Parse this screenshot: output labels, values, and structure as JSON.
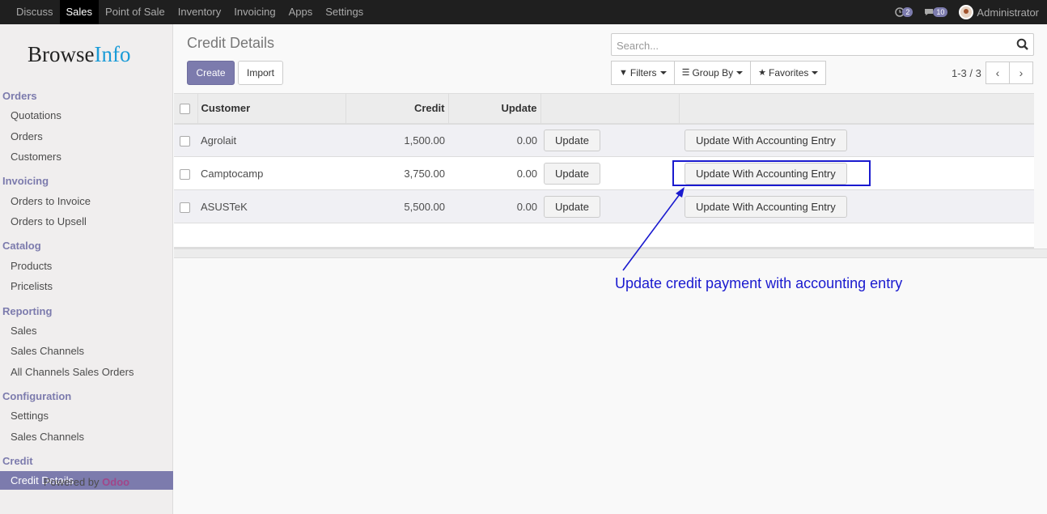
{
  "topbar": {
    "menu": [
      "Discuss",
      "Sales",
      "Point of Sale",
      "Inventory",
      "Invoicing",
      "Apps",
      "Settings"
    ],
    "active": "Sales",
    "activity_count": "2",
    "message_count": "10",
    "user": "Administrator"
  },
  "sidebar": {
    "logo_a": "Browse",
    "logo_b": "Info",
    "sections": {
      "orders": "Orders",
      "invoicing": "Invoicing",
      "catalog": "Catalog",
      "reporting": "Reporting",
      "configuration": "Configuration",
      "credit": "Credit"
    },
    "items": {
      "quotations": "Quotations",
      "orders": "Orders",
      "customers": "Customers",
      "orders_to_invoice": "Orders to Invoice",
      "orders_to_upsell": "Orders to Upsell",
      "products": "Products",
      "pricelists": "Pricelists",
      "sales": "Sales",
      "sales_channels": "Sales Channels",
      "all_channels": "All Channels Sales Orders",
      "settings": "Settings",
      "config_sales_channels": "Sales Channels",
      "credit_details": "Credit Details"
    },
    "powered_by": "Powered by",
    "odoo": "Odoo"
  },
  "control": {
    "title": "Credit Details",
    "create": "Create",
    "import": "Import",
    "search_placeholder": "Search...",
    "filters": "Filters",
    "group_by": "Group By",
    "favorites": "Favorites",
    "pager": "1-3 / 3"
  },
  "table": {
    "headers": {
      "customer": "Customer",
      "credit": "Credit",
      "update": "Update"
    },
    "rows": [
      {
        "customer": "Agrolait",
        "credit": "1,500.00",
        "update": "0.00",
        "btn": "Update",
        "btn2": "Update With Accounting Entry"
      },
      {
        "customer": "Camptocamp",
        "credit": "3,750.00",
        "update": "0.00",
        "btn": "Update",
        "btn2": "Update With Accounting Entry"
      },
      {
        "customer": "ASUSTeK",
        "credit": "5,500.00",
        "update": "0.00",
        "btn": "Update",
        "btn2": "Update With Accounting Entry"
      }
    ]
  },
  "annotation": "Update credit payment with accounting entry",
  "colors": {
    "primary": "#7c7bad",
    "annotation": "#1a1acf",
    "odoo": "#a24689"
  }
}
